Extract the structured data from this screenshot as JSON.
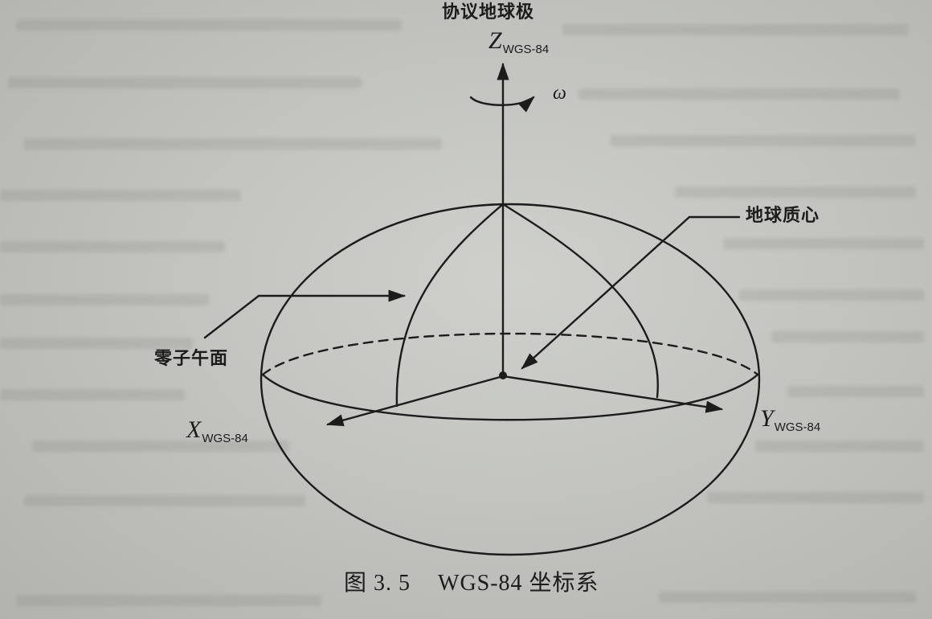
{
  "labels": {
    "pole": "协议地球极",
    "z_axis": {
      "letter": "Z",
      "sub": "WGS-84"
    },
    "omega": "ω",
    "center_of_mass": "地球质心",
    "zero_meridian": "零子午面",
    "x_axis": {
      "letter": "X",
      "sub": "WGS-84"
    },
    "y_axis": {
      "letter": "Y",
      "sub": "WGS-84"
    }
  },
  "caption": {
    "number": "图 3. 5",
    "title": "WGS-84 坐标系"
  },
  "colors": {
    "ink": "#1c1c1c",
    "paper": "#c6c7c2"
  }
}
